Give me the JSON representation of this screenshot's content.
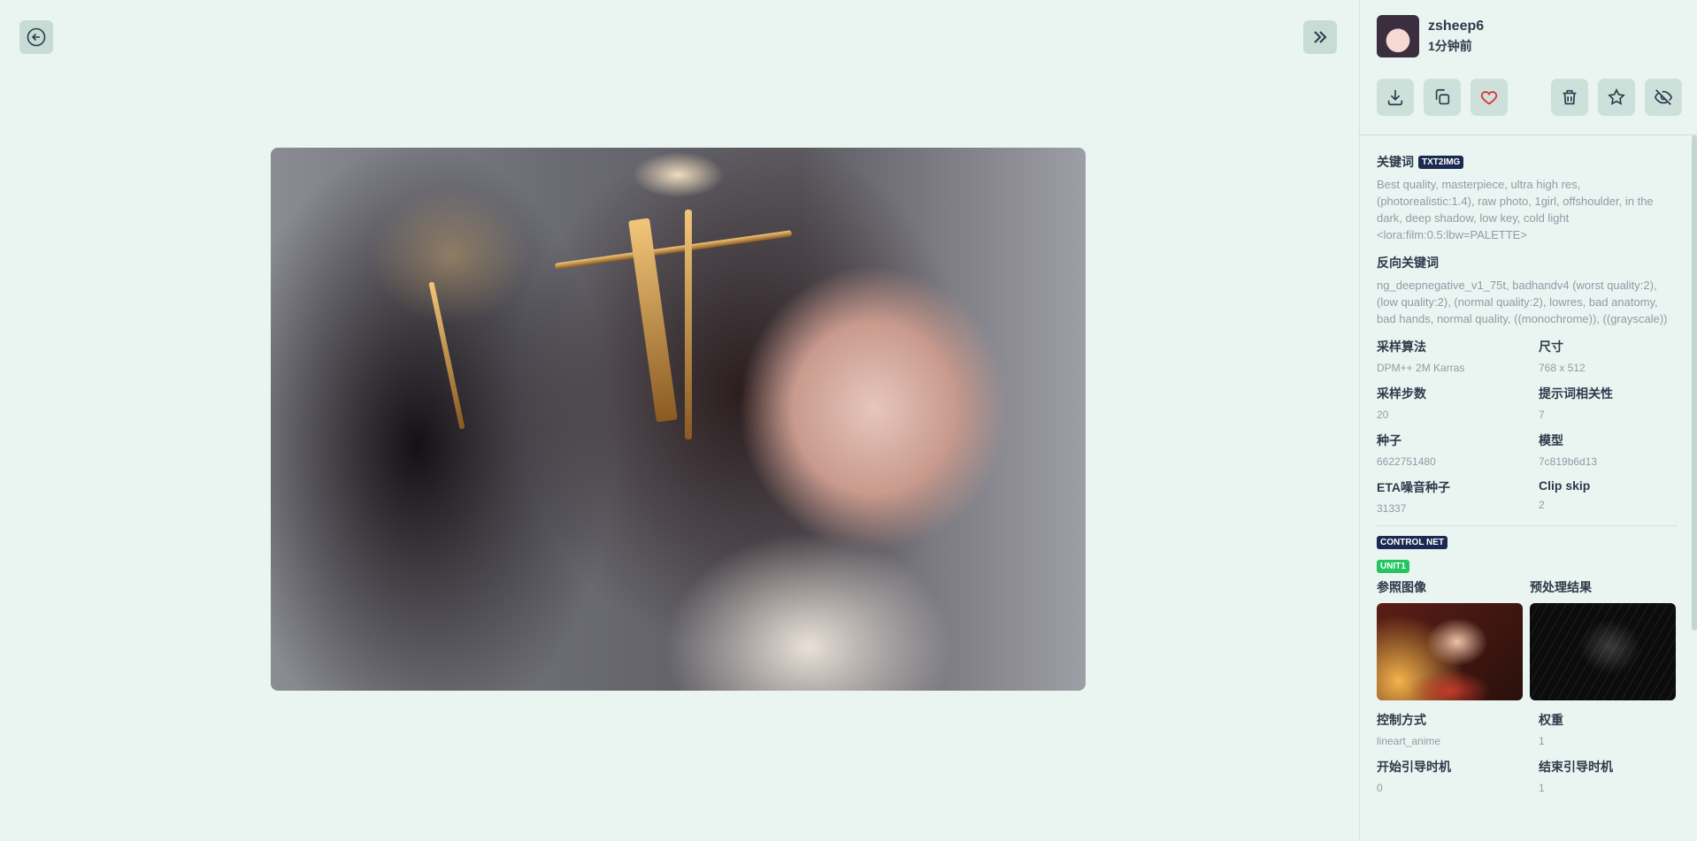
{
  "nav": {
    "back_icon": "back-circle-icon",
    "collapse_icon": "double-chevron-right-icon"
  },
  "user": {
    "name": "zsheep6",
    "time": "1分钟前"
  },
  "actions": {
    "download": "download-icon",
    "copy": "copy-icon",
    "like": "heart-icon",
    "delete": "trash-icon",
    "favorite": "star-icon",
    "hide": "eye-off-icon"
  },
  "prompt": {
    "label": "关键词",
    "tag": "TXT2IMG",
    "text": "Best quality, masterpiece, ultra high res, (photorealistic:1.4), raw photo, 1girl, offshoulder, in the dark, deep shadow, low key, cold light <lora:film:0.5:lbw=PALETTE>"
  },
  "negative": {
    "label": "反向关键词",
    "text": "ng_deepnegative_v1_75t, badhandv4 (worst quality:2), (low quality:2), (normal quality:2), lowres, bad anatomy, bad hands, normal quality, ((monochrome)), ((grayscale))"
  },
  "params": [
    {
      "k": "采样算法",
      "v": "DPM++ 2M Karras"
    },
    {
      "k": "尺寸",
      "v": "768 x 512"
    },
    {
      "k": "采样步数",
      "v": "20"
    },
    {
      "k": "提示词相关性",
      "v": "7"
    },
    {
      "k": "种子",
      "v": "6622751480"
    },
    {
      "k": "模型",
      "v": "7c819b6d13"
    },
    {
      "k": "ETA噪音种子",
      "v": "31337"
    },
    {
      "k": "Clip skip",
      "v": "2"
    }
  ],
  "controlnet": {
    "tag": "CONTROL NET",
    "unit": "UNIT1",
    "ref_label": "参照图像",
    "pre_label": "预处理结果",
    "params": [
      {
        "k": "控制方式",
        "v": "lineart_anime"
      },
      {
        "k": "权重",
        "v": "1"
      },
      {
        "k": "开始引导时机",
        "v": "0"
      },
      {
        "k": "结束引导时机",
        "v": "1"
      }
    ]
  },
  "colors": {
    "background": "#eaf5f1",
    "button_bg": "#cde0da",
    "tag_dark": "#1b2a52",
    "tag_green": "#22c55e",
    "heart": "#e0323a"
  }
}
